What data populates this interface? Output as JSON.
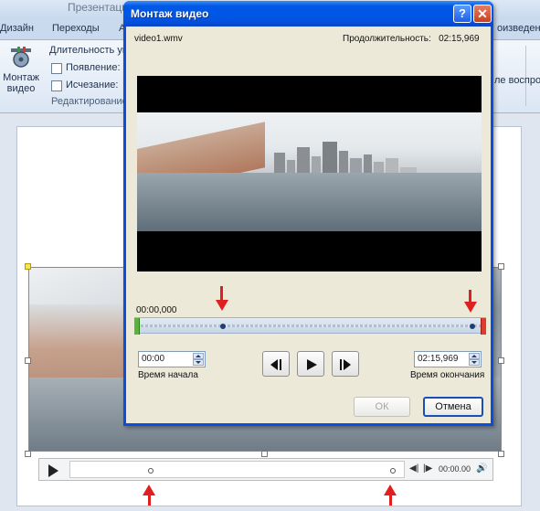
{
  "ribbon": {
    "title": "Презентаци",
    "tabs": [
      "Дизайн",
      "Переходы",
      "А",
      "оизведени"
    ],
    "trim_button": {
      "line1": "Монтаж",
      "line2": "видео"
    },
    "labels": {
      "duration": "Длительность угас",
      "fade_in": "Появление:",
      "fade_out": "Исчезание:",
      "playback": "ле воспро"
    },
    "group": "Редактирование"
  },
  "dialog": {
    "title": "Монтаж видео",
    "help_glyph": "?",
    "close_glyph": "✕",
    "file_name": "video1.wmv",
    "duration_label": "Продолжительность:",
    "duration_value": "02:15,969",
    "current_time": "00:00,000",
    "start_time": {
      "value": "00:00",
      "label": "Время начала"
    },
    "end_time": {
      "value": "02:15,969",
      "label": "Время окончания"
    },
    "ok_label": "ОК",
    "cancel_label": "Отмена"
  },
  "player": {
    "time": "00:00.00"
  },
  "colors": {
    "arrow": "#e02020",
    "title_bar": "#0055e5",
    "start_marker": "#57b53b",
    "end_marker": "#e03a2f"
  }
}
